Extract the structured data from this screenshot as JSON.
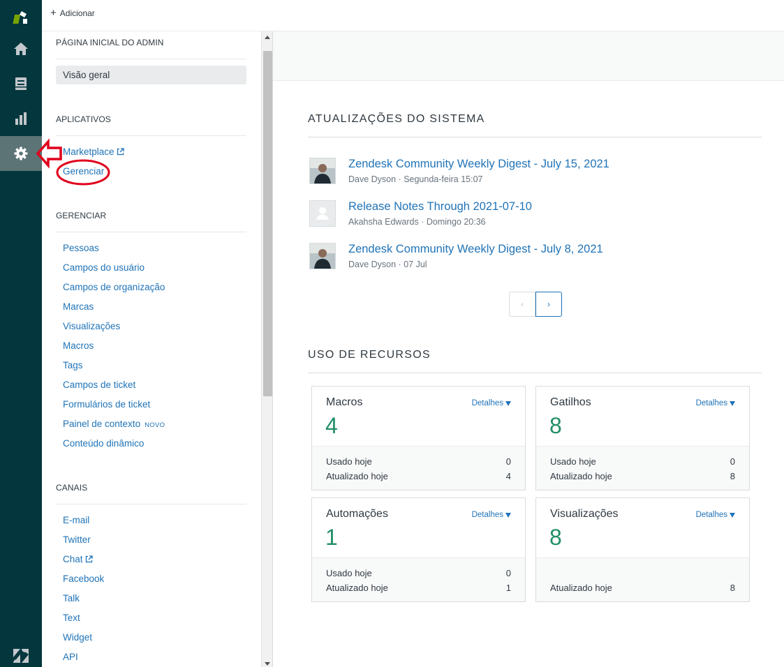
{
  "topbar": {
    "add_label": "Adicionar"
  },
  "nav": {
    "admin_home_title": "PÁGINA INICIAL DO ADMIN",
    "overview": "Visão geral",
    "apps_title": "APLICATIVOS",
    "apps": [
      "Marketplace",
      "Gerenciar"
    ],
    "manage_title": "GERENCIAR",
    "manage": [
      "Pessoas",
      "Campos do usuário",
      "Campos de organização",
      "Marcas",
      "Visualizações",
      "Macros",
      "Tags",
      "Campos de ticket",
      "Formulários de ticket",
      "Painel de contexto",
      "Conteúdo dinâmico"
    ],
    "new_badge": "NOVO",
    "channels_title": "CANAIS",
    "channels": [
      "E-mail",
      "Twitter",
      "Chat",
      "Facebook",
      "Talk",
      "Text",
      "Widget",
      "API"
    ]
  },
  "updates": {
    "title": "ATUALIZAÇÕES DO SISTEMA",
    "items": [
      {
        "title": "Zendesk Community Weekly Digest - July 15, 2021",
        "meta": "Dave Dyson · Segunda-feira 15:07"
      },
      {
        "title": "Release Notes Through 2021-07-10",
        "meta": "Akahsha Edwards · Domingo 20:36"
      },
      {
        "title": "Zendesk Community Weekly Digest - July 8, 2021",
        "meta": "Dave Dyson · 07 Jul"
      }
    ],
    "pager_prev": "‹",
    "pager_next": "›"
  },
  "resources": {
    "title": "USO DE RECURSOS",
    "details_label": "Detalhes",
    "cards": [
      {
        "name": "Macros",
        "count": "4",
        "used_label": "Usado hoje",
        "used": "0",
        "updated_label": "Atualizado hoje",
        "updated": "4"
      },
      {
        "name": "Gatilhos",
        "count": "8",
        "used_label": "Usado hoje",
        "used": "0",
        "updated_label": "Atualizado hoje",
        "updated": "8"
      },
      {
        "name": "Automações",
        "count": "1",
        "used_label": "Usado hoje",
        "used": "0",
        "updated_label": "Atualizado hoje",
        "updated": "1"
      },
      {
        "name": "Visualizações",
        "count": "8",
        "updated_label": "Atualizado hoje",
        "updated": "8"
      }
    ]
  },
  "colors": {
    "rail": "#03363d",
    "link": "#1f73b7",
    "count": "#228f67",
    "annotation": "#e0001b"
  }
}
